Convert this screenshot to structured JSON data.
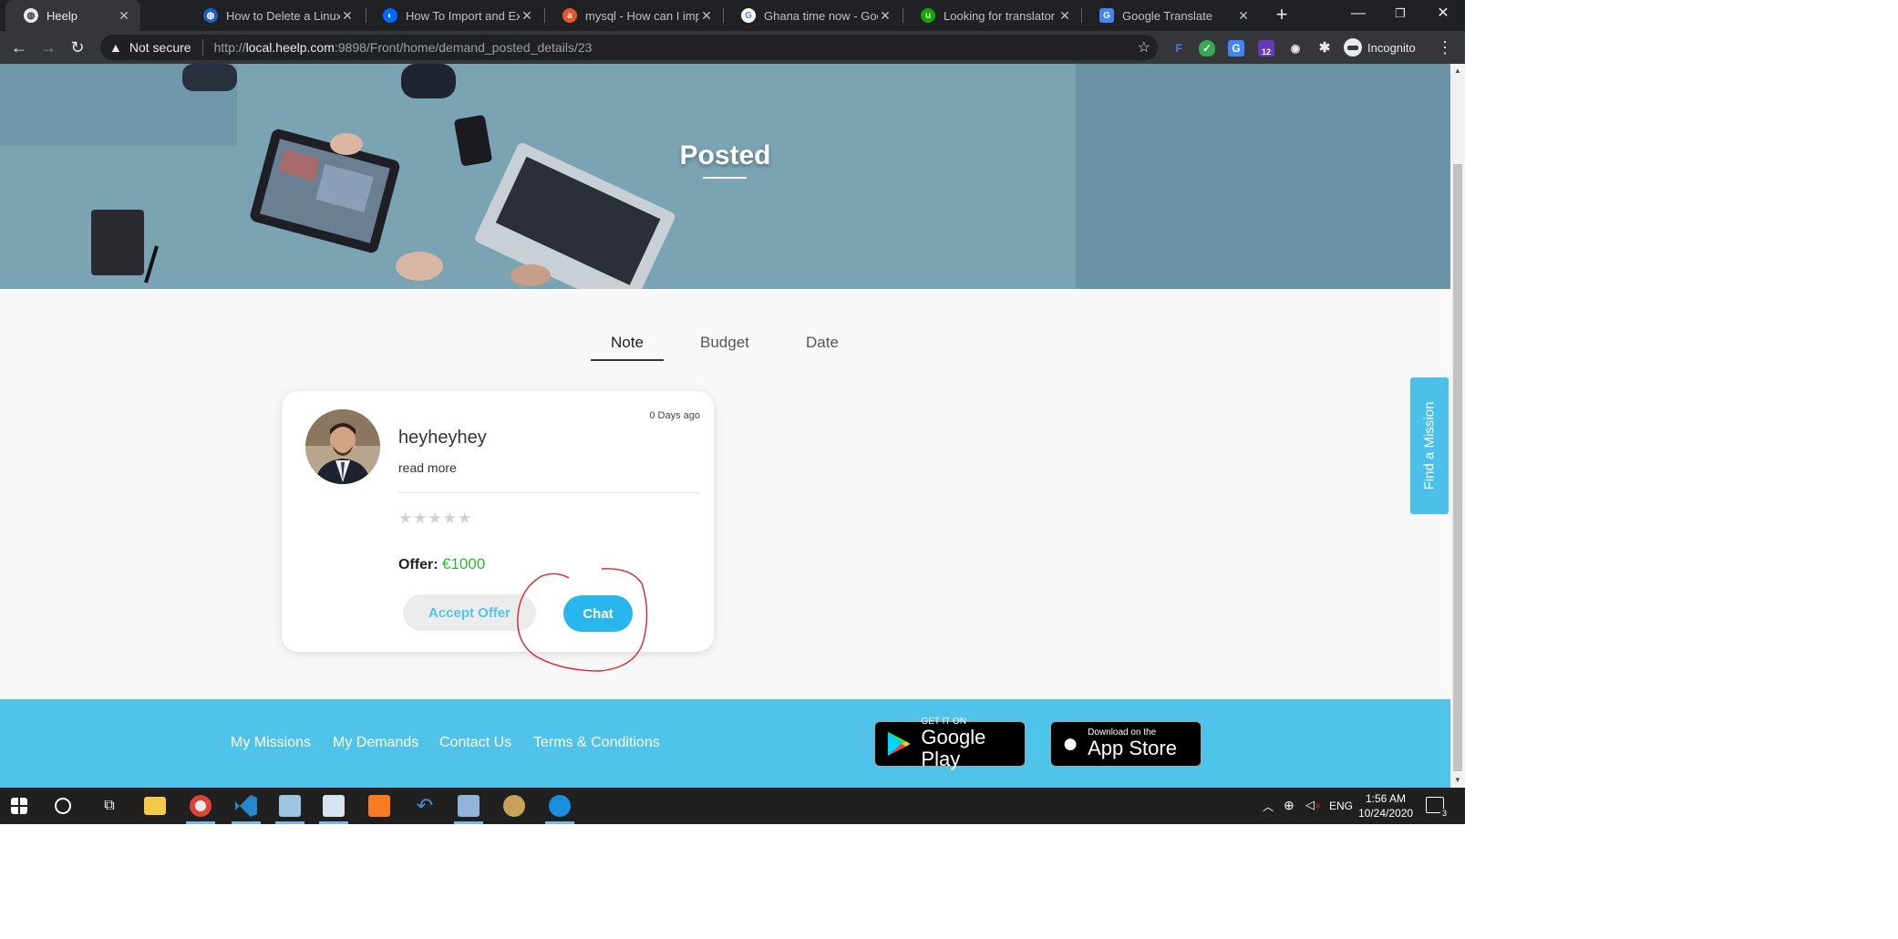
{
  "browser": {
    "tabs": [
      {
        "title": "Heelp",
        "active": true
      },
      {
        "title": "How to Delete a Linux Fil",
        "active": false
      },
      {
        "title": "How To Import and Expo",
        "active": false
      },
      {
        "title": "mysql - How can I impo",
        "active": false
      },
      {
        "title": "Ghana time now - Googl",
        "active": false
      },
      {
        "title": "Looking for translator fo",
        "active": false
      },
      {
        "title": "Google Translate",
        "active": false
      }
    ],
    "security_label": "Not secure",
    "url_scheme": "http://",
    "url_host": "local.heelp.com",
    "url_rest": ":9898/Front/home/demand_posted_details/23",
    "incognito_label": "Incognito",
    "extension_badge": "12"
  },
  "page": {
    "hero_title": "Posted",
    "tabs": [
      {
        "label": "Note",
        "active": true
      },
      {
        "label": "Budget",
        "active": false
      },
      {
        "label": "Date",
        "active": false
      }
    ],
    "offer_card": {
      "time_ago": "0 Days ago",
      "name": "heyheyhey",
      "read_more": "read more",
      "rating": 0,
      "rating_max": 5,
      "stars": "★★★★★",
      "offer_label": "Offer:",
      "offer_amount": "€1000",
      "accept_label": "Accept Offer",
      "chat_label": "Chat"
    },
    "find_mission_label": "Find a Mission",
    "footer": {
      "links": [
        "My Missions",
        "My Demands",
        "Contact Us",
        "Terms & Conditions"
      ],
      "google_play": {
        "small": "GET IT ON",
        "big": "Google Play"
      },
      "app_store": {
        "small": "Download on the",
        "big": "App Store"
      }
    }
  },
  "taskbar": {
    "language": "ENG",
    "time": "1:56 AM",
    "date": "10/24/2020",
    "notification_count": "3"
  },
  "colors": {
    "accent": "#4fc3ea",
    "chat_button": "#29b6ee",
    "offer_amount": "#2eb82e",
    "annotation": "#e0202a"
  }
}
